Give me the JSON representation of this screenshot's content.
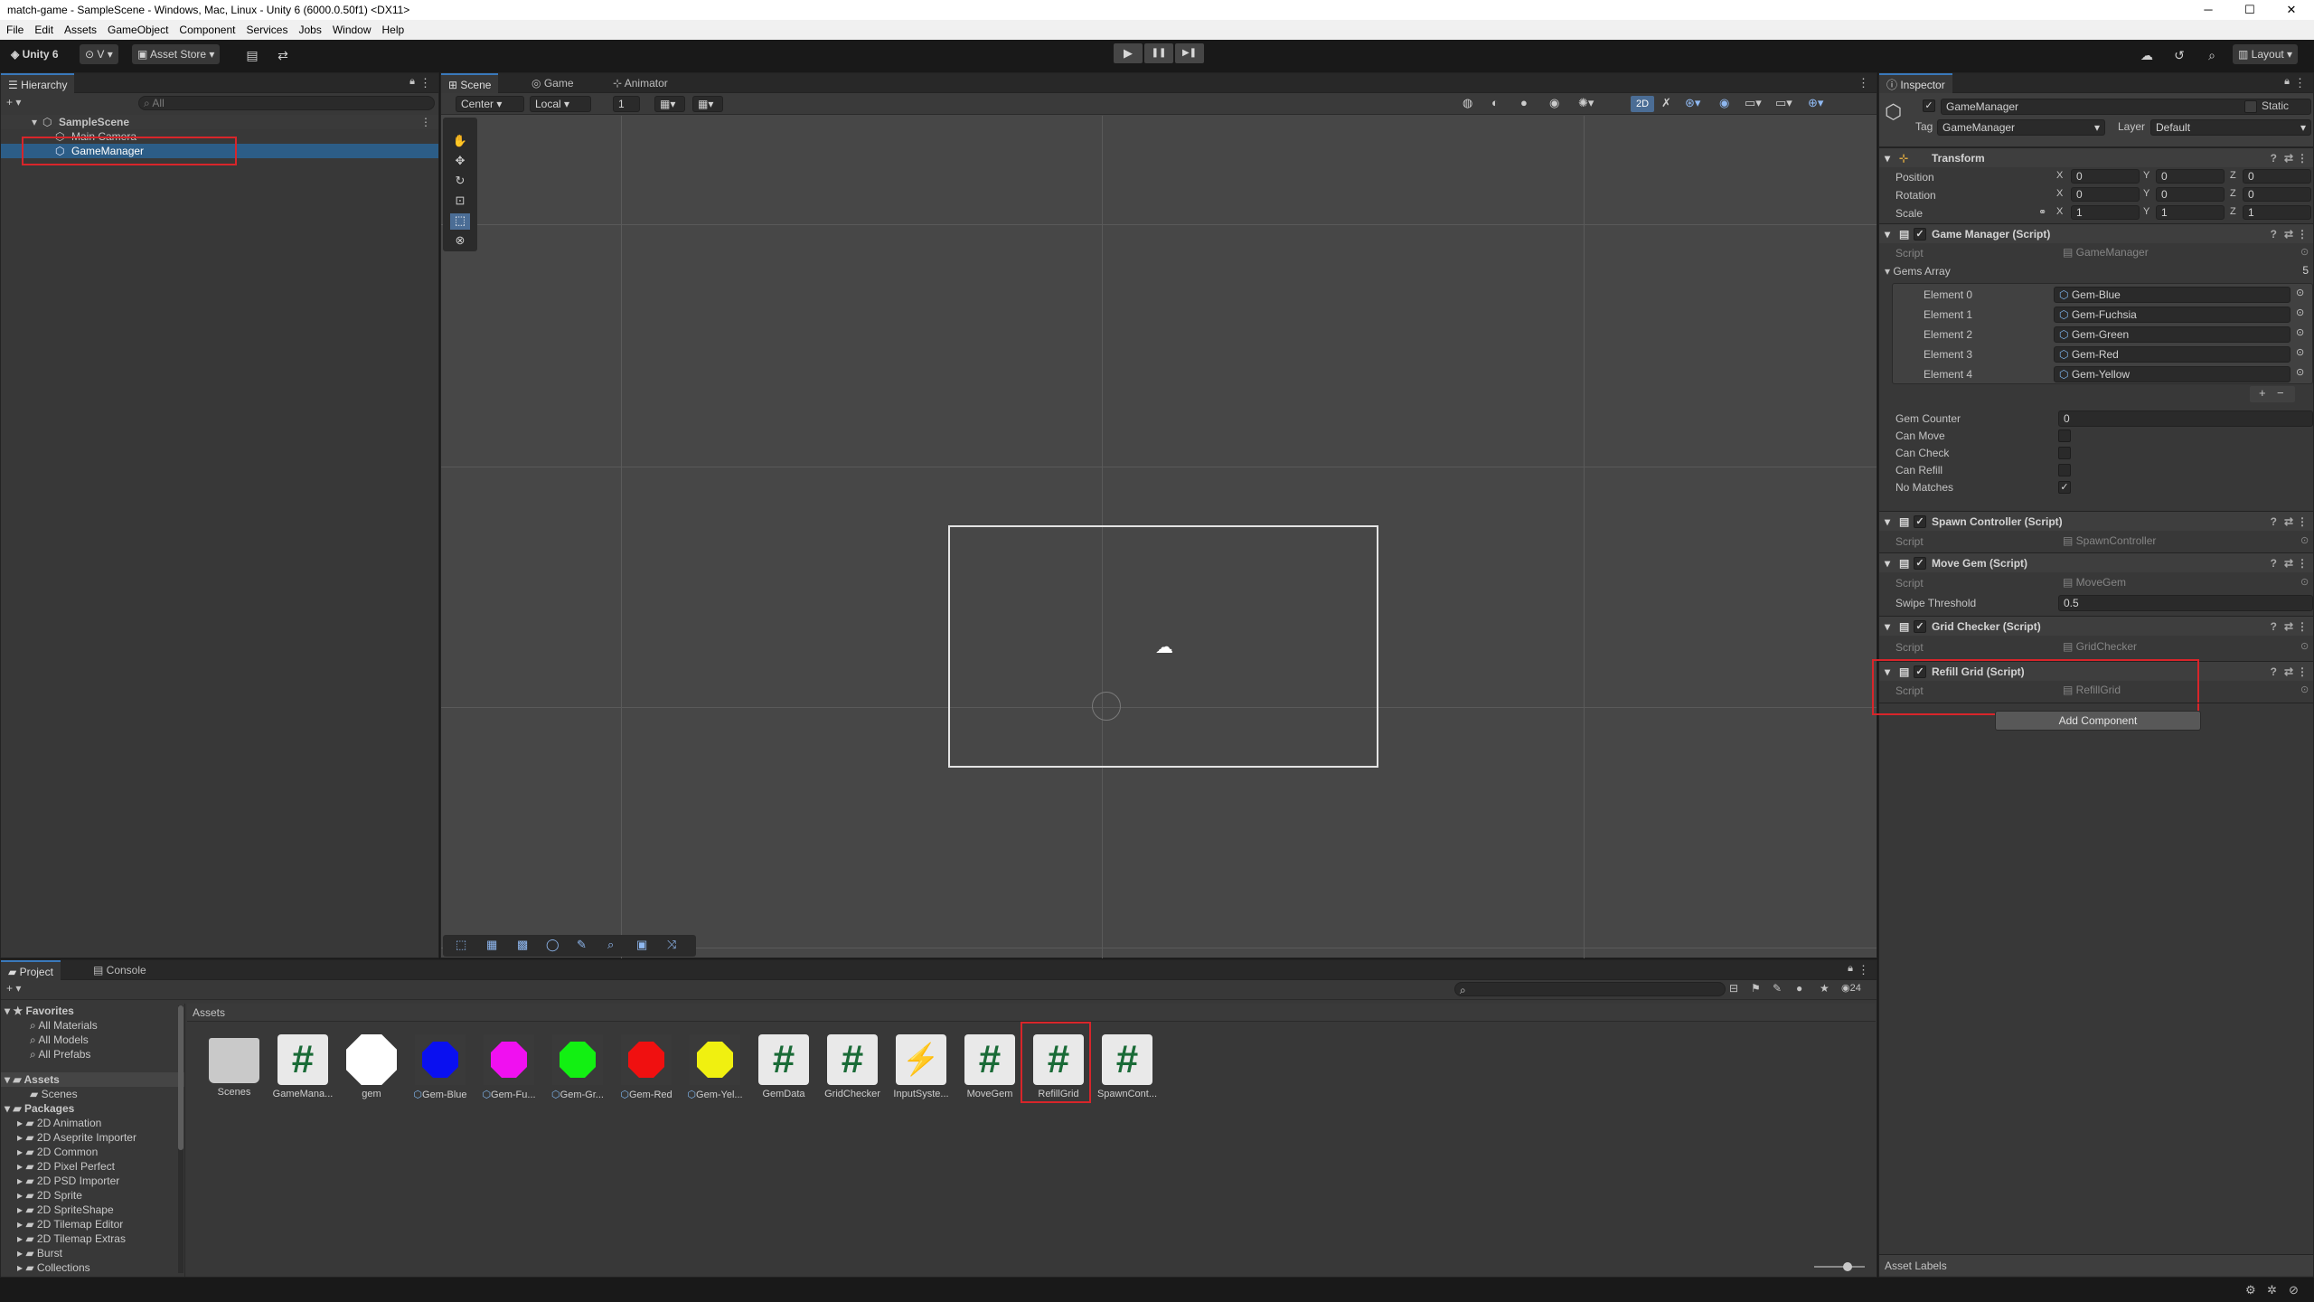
{
  "window": {
    "title": "match-game - SampleScene - Windows, Mac, Linux - Unity 6 (6000.0.50f1) <DX11>",
    "min": "─",
    "max": "☐",
    "close": "✕"
  },
  "menu": [
    "File",
    "Edit",
    "Assets",
    "GameObject",
    "Component",
    "Services",
    "Jobs",
    "Window",
    "Help"
  ],
  "toolbar": {
    "account": "Unity 6",
    "version_btn": "V ▾",
    "asset_store": "Asset Store ▾",
    "layout": "Layout ▾",
    "play": "▶",
    "pause": "❚❚",
    "step": "▶❚"
  },
  "hierarchy": {
    "tab": "Hierarchy",
    "search_placeholder": "All",
    "add": "+ ▾",
    "scene": "SampleScene",
    "items": [
      "Main Camera",
      "GameManager"
    ]
  },
  "scene": {
    "tabs": [
      "Scene",
      "Game",
      "Animator"
    ],
    "pivot": "Center ▾",
    "space": "Local ▾",
    "snap_value": "1",
    "mode_2d": "2D"
  },
  "inspector": {
    "tab": "Inspector",
    "object_name": "GameManager",
    "static_label": "Static",
    "tag_label": "Tag",
    "tag_value": "GameManager",
    "layer_label": "Layer",
    "layer_value": "Default",
    "transform": {
      "title": "Transform",
      "rows": [
        {
          "label": "Position",
          "x": "0",
          "y": "0",
          "z": "0"
        },
        {
          "label": "Rotation",
          "x": "0",
          "y": "0",
          "z": "0"
        },
        {
          "label": "Scale",
          "x": "1",
          "y": "1",
          "z": "1"
        }
      ]
    },
    "game_manager": {
      "title": "Game Manager (Script)",
      "script_label": "Script",
      "script_value": "GameManager",
      "gems_label": "Gems Array",
      "gems_count": "5",
      "elements": [
        {
          "label": "Element 0",
          "value": "Gem-Blue"
        },
        {
          "label": "Element 1",
          "value": "Gem-Fuchsia"
        },
        {
          "label": "Element 2",
          "value": "Gem-Green"
        },
        {
          "label": "Element 3",
          "value": "Gem-Red"
        },
        {
          "label": "Element 4",
          "value": "Gem-Yellow"
        }
      ],
      "gem_counter_label": "Gem Counter",
      "gem_counter_value": "0",
      "can_move": "Can Move",
      "can_check": "Can Check",
      "can_refill": "Can Refill",
      "no_matches": "No Matches",
      "plus": "+",
      "minus": "−"
    },
    "spawn": {
      "title": "Spawn Controller (Script)",
      "script_label": "Script",
      "script_value": "SpawnController"
    },
    "move": {
      "title": "Move Gem (Script)",
      "script_label": "Script",
      "script_value": "MoveGem",
      "threshold_label": "Swipe Threshold",
      "threshold_value": "0.5"
    },
    "grid": {
      "title": "Grid Checker (Script)",
      "script_label": "Script",
      "script_value": "GridChecker"
    },
    "refill": {
      "title": "Refill Grid (Script)",
      "script_label": "Script",
      "script_value": "RefillGrid"
    },
    "add_component": "Add Component",
    "asset_labels": "Asset Labels"
  },
  "project": {
    "tabs": [
      "Project",
      "Console"
    ],
    "breadcrumb": "Assets",
    "count": "24",
    "favorites": {
      "label": "Favorites",
      "items": [
        "All Materials",
        "All Models",
        "All Prefabs"
      ]
    },
    "assets_label": "Assets",
    "scenes_label": "Scenes",
    "packages_label": "Packages",
    "packages": [
      "2D Animation",
      "2D Aseprite Importer",
      "2D Common",
      "2D Pixel Perfect",
      "2D PSD Importer",
      "2D Sprite",
      "2D SpriteShape",
      "2D Tilemap Editor",
      "2D Tilemap Extras",
      "Burst",
      "Collections"
    ],
    "assets": [
      {
        "label": "Scenes",
        "kind": "folder"
      },
      {
        "label": "GameMana...",
        "kind": "script"
      },
      {
        "label": "gem",
        "kind": "gem-white"
      },
      {
        "label": "Gem-Blue",
        "kind": "gem",
        "color": "#0a10f0"
      },
      {
        "label": "Gem-Fu...",
        "kind": "gem",
        "color": "#f010f0"
      },
      {
        "label": "Gem-Gr...",
        "kind": "gem",
        "color": "#12f012"
      },
      {
        "label": "Gem-Red",
        "kind": "gem",
        "color": "#f01010"
      },
      {
        "label": "Gem-Yel...",
        "kind": "gem",
        "color": "#f0f010"
      },
      {
        "label": "GemData",
        "kind": "script"
      },
      {
        "label": "GridChecker",
        "kind": "script"
      },
      {
        "label": "InputSyste...",
        "kind": "input"
      },
      {
        "label": "MoveGem",
        "kind": "script"
      },
      {
        "label": "RefillGrid",
        "kind": "script"
      },
      {
        "label": "SpawnCont...",
        "kind": "script"
      }
    ]
  },
  "icons": {
    "hash": "#",
    "check": "✓",
    "triangle_down": "▾",
    "triangle_right": "▸"
  }
}
